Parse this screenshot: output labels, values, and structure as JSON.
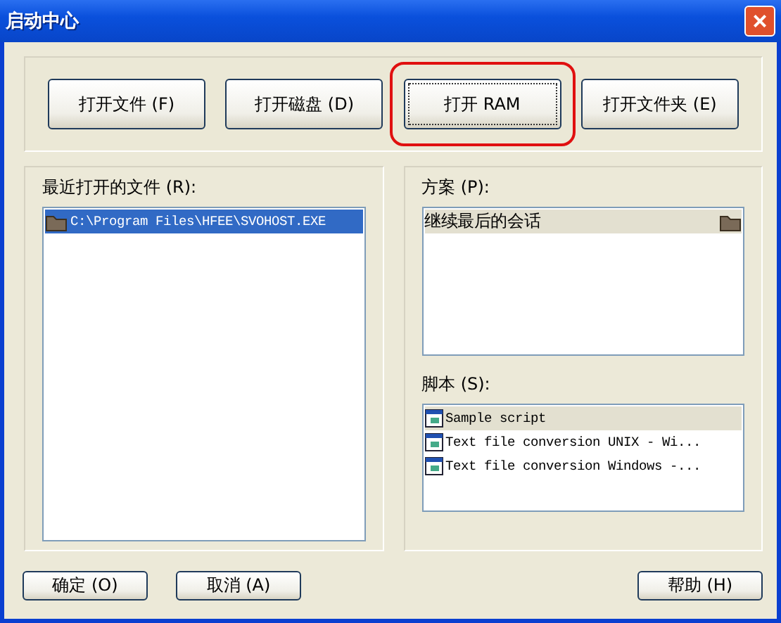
{
  "window": {
    "title": "启动中心",
    "close": "×"
  },
  "top_buttons": [
    {
      "label": "打开文件 (F)",
      "highlighted": false
    },
    {
      "label": "打开磁盘 (D)",
      "highlighted": false
    },
    {
      "label": "打开 RAM",
      "highlighted": true
    },
    {
      "label": "打开文件夹 (E)",
      "highlighted": false
    }
  ],
  "recent_files": {
    "label": "最近打开的文件 (R):",
    "items": [
      {
        "text": "C:\\Program Files\\HFEE\\SVOHOST.EXE",
        "selected": true
      }
    ]
  },
  "schemes": {
    "label": "方案 (P):",
    "items": [
      {
        "text": "继续最后的会话",
        "selected": true
      }
    ]
  },
  "scripts": {
    "label": "脚本 (S):",
    "items": [
      {
        "text": "Sample script",
        "selected": true
      },
      {
        "text": "Text file conversion UNIX - Wi...",
        "selected": false
      },
      {
        "text": "Text file conversion Windows -...",
        "selected": false
      }
    ]
  },
  "bottom_left_buttons": [
    "确定 (O)",
    "取消 (A)"
  ],
  "bottom_right_buttons": [
    "帮助 (H)"
  ]
}
